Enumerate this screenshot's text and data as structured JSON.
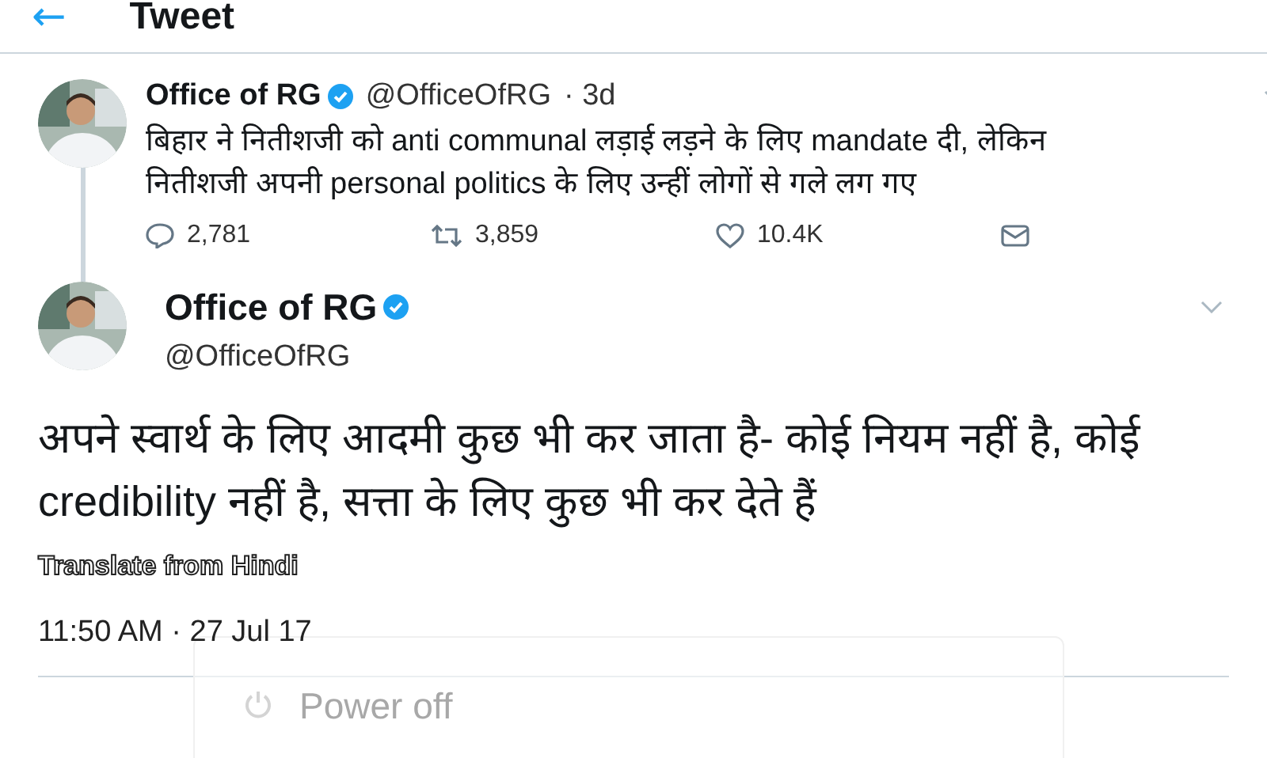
{
  "header": {
    "back": "←",
    "title": "Tweet"
  },
  "parent_tweet": {
    "name": "Office of RG",
    "verified": true,
    "handle": "@OfficeOfRG",
    "age": "· 3d",
    "text": "बिहार ने नितीशजी को anti communal लड़ाई लड़ने के लिए mandate दी, लेकिन नितीशजी अपनी personal politics के लिए उन्हीं लोगों से गले लग गए",
    "actions": [
      {
        "kind": "reply",
        "count": "2,781"
      },
      {
        "kind": "retweet",
        "count": "3,859"
      },
      {
        "kind": "like",
        "count": "10.4K"
      },
      {
        "kind": "message"
      }
    ]
  },
  "main_tweet": {
    "name": "Office of RG",
    "verified": true,
    "handle": "@OfficeOfRG",
    "text": "अपने स्वार्थ के लिए आदमी कुछ भी कर जाता है- कोई नियम नहीं है, कोई credibility नहीं है, सत्ता के लिए कुछ भी कर देते हैं",
    "translate": "Translate from Hindi",
    "timestamp": "11:50 AM · 27 Jul 17"
  },
  "overlay_menu": {
    "item": "Power off"
  }
}
